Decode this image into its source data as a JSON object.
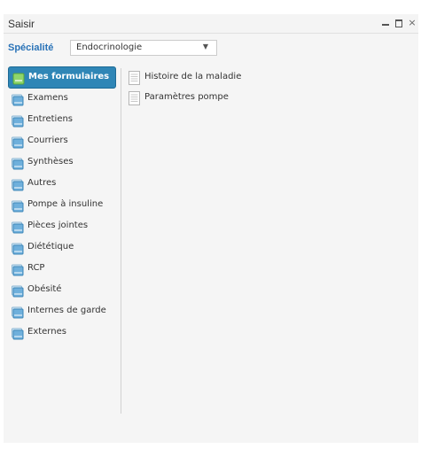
{
  "window": {
    "title": "Saisir",
    "controls": {
      "minimize_icon": "minimize-icon",
      "maximize_icon": "maximize-icon",
      "close_icon": "close-icon",
      "close_glyph": "×"
    }
  },
  "specialite": {
    "label": "Spécialité",
    "selected": "Endocrinologie",
    "arrow_glyph": "▼"
  },
  "nav": {
    "items": [
      {
        "label": "Mes formulaires",
        "active": true
      },
      {
        "label": "Examens"
      },
      {
        "label": "Entretiens"
      },
      {
        "label": "Courriers"
      },
      {
        "label": "Synthèses"
      },
      {
        "label": "Autres"
      },
      {
        "label": "Pompe à insuline"
      },
      {
        "label": "Pièces jointes"
      },
      {
        "label": "Diététique"
      },
      {
        "label": "RCP"
      },
      {
        "label": "Obésité"
      },
      {
        "label": "Internes de garde"
      },
      {
        "label": "Externes"
      }
    ],
    "icon": "folder-icon"
  },
  "forms": {
    "items": [
      {
        "label": "Histoire de la maladie"
      },
      {
        "label": "Paramètres pompe"
      }
    ],
    "icon": "form-document-icon"
  },
  "colors": {
    "accent": "#2f86b6",
    "label_blue": "#2a73b8",
    "panel_bg": "#f5f5f5"
  }
}
